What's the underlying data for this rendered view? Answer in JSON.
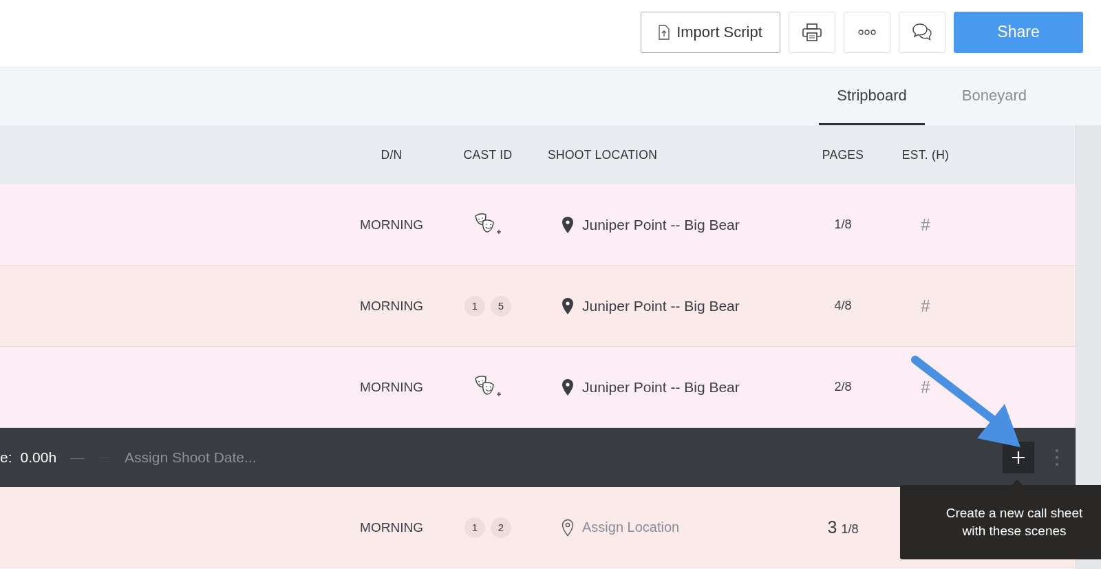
{
  "toolbar": {
    "buttons": [
      {
        "kind": "import",
        "label": "Import Script"
      },
      {
        "kind": "print"
      },
      {
        "kind": "more"
      },
      {
        "kind": "comments"
      },
      {
        "kind": "share",
        "label": "Share"
      }
    ]
  },
  "tabs": [
    {
      "label": "Stripboard",
      "selected": true
    },
    {
      "label": "Boneyard",
      "selected": false
    }
  ],
  "table": {
    "columns": [
      "D/N",
      "CAST ID",
      "SHOOT LOCATION",
      "PAGES",
      "EST. (H)"
    ],
    "rows": [
      {
        "kind": "scene",
        "color": "#fdedf5",
        "time": "MORNING",
        "cast": {
          "kind": "add"
        },
        "location": {
          "text": "Juniper Point -- Big Bear",
          "assigned": true
        },
        "pages": {
          "fraction": "1/8"
        },
        "est": "#"
      },
      {
        "kind": "scene",
        "color": "#fbeaea",
        "time": "MORNING",
        "cast": {
          "kind": "ids",
          "ids": [
            "1",
            "5"
          ]
        },
        "location": {
          "text": "Juniper Point -- Big Bear",
          "assigned": true
        },
        "pages": {
          "fraction": "4/8"
        },
        "est": "#"
      },
      {
        "kind": "scene",
        "color": "#fdedf5",
        "time": "MORNING",
        "cast": {
          "kind": "add"
        },
        "location": {
          "text": "Juniper Point -- Big Bear",
          "assigned": true
        },
        "pages": {
          "fraction": "2/8"
        },
        "est": "#"
      },
      {
        "kind": "day",
        "label": "e:",
        "total": "0.00h",
        "separator": "—",
        "date": {
          "placeholder": "Assign Shoot Date..."
        }
      },
      {
        "kind": "scene",
        "color": "#fbeaea",
        "time": "MORNING",
        "cast": {
          "kind": "ids",
          "ids": [
            "1",
            "2"
          ]
        },
        "location": {
          "text": "Assign Location",
          "assigned": false
        },
        "pages": {
          "whole": "3",
          "fraction": "1/8"
        }
      }
    ]
  },
  "tooltip": {
    "text": "Create a new call sheet with these scenes"
  }
}
